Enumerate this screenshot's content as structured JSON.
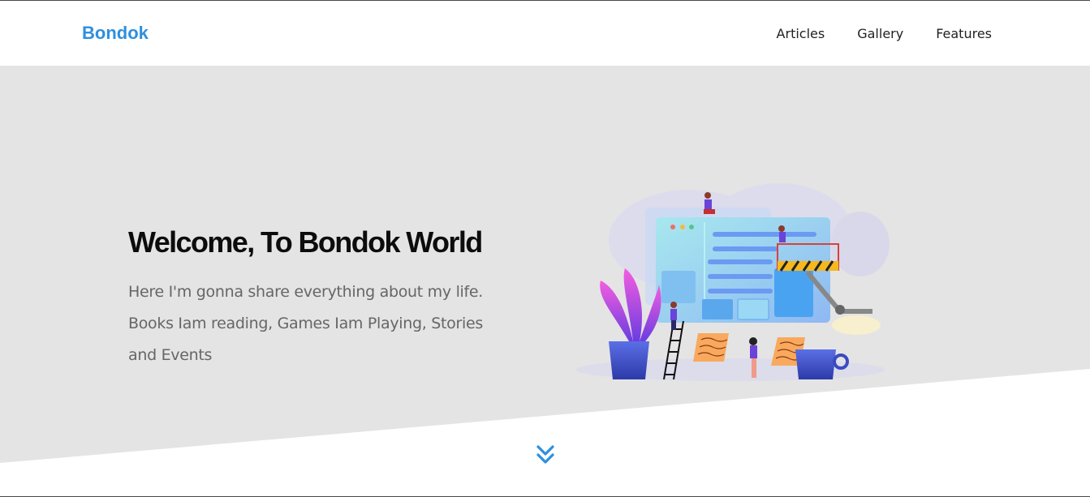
{
  "header": {
    "logo": "Bondok",
    "nav": [
      {
        "label": "Articles"
      },
      {
        "label": "Gallery"
      },
      {
        "label": "Features"
      }
    ]
  },
  "hero": {
    "title": "Welcome, To Bondok World",
    "description": "Here I'm gonna share everything about my life. Books Iam reading, Games Iam Playing, Stories and Events",
    "illustration_icon": "website-builders-illustration"
  },
  "scroll": {
    "icon": "double-chevron-down-icon"
  },
  "colors": {
    "brand": "#2e8fe0",
    "hero_bg": "#e4e4e4"
  }
}
